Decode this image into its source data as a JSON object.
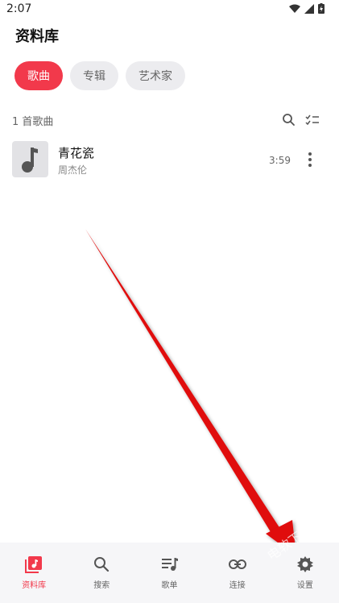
{
  "status_bar": {
    "time": "2:07"
  },
  "page": {
    "title": "资料库"
  },
  "chips": [
    {
      "label": "歌曲",
      "active": true
    },
    {
      "label": "专辑",
      "active": false
    },
    {
      "label": "艺术家",
      "active": false
    }
  ],
  "list_header": {
    "count_text": "1 首歌曲"
  },
  "songs": [
    {
      "title": "青花瓷",
      "artist": "周杰伦",
      "duration": "3:59"
    }
  ],
  "bottom_nav": [
    {
      "label": "资料库",
      "icon": "library-icon",
      "active": true
    },
    {
      "label": "搜索",
      "icon": "search-icon",
      "active": false
    },
    {
      "label": "歌单",
      "icon": "playlist-icon",
      "active": false
    },
    {
      "label": "连接",
      "icon": "link-icon",
      "active": false
    },
    {
      "label": "设置",
      "icon": "gear-icon",
      "active": false
    }
  ],
  "colors": {
    "accent": "#f2394b",
    "nav_background": "#f6f6f8",
    "chip_inactive": "#ececef",
    "annotation_arrow": "#e01010"
  },
  "watermark": "电软下载站"
}
